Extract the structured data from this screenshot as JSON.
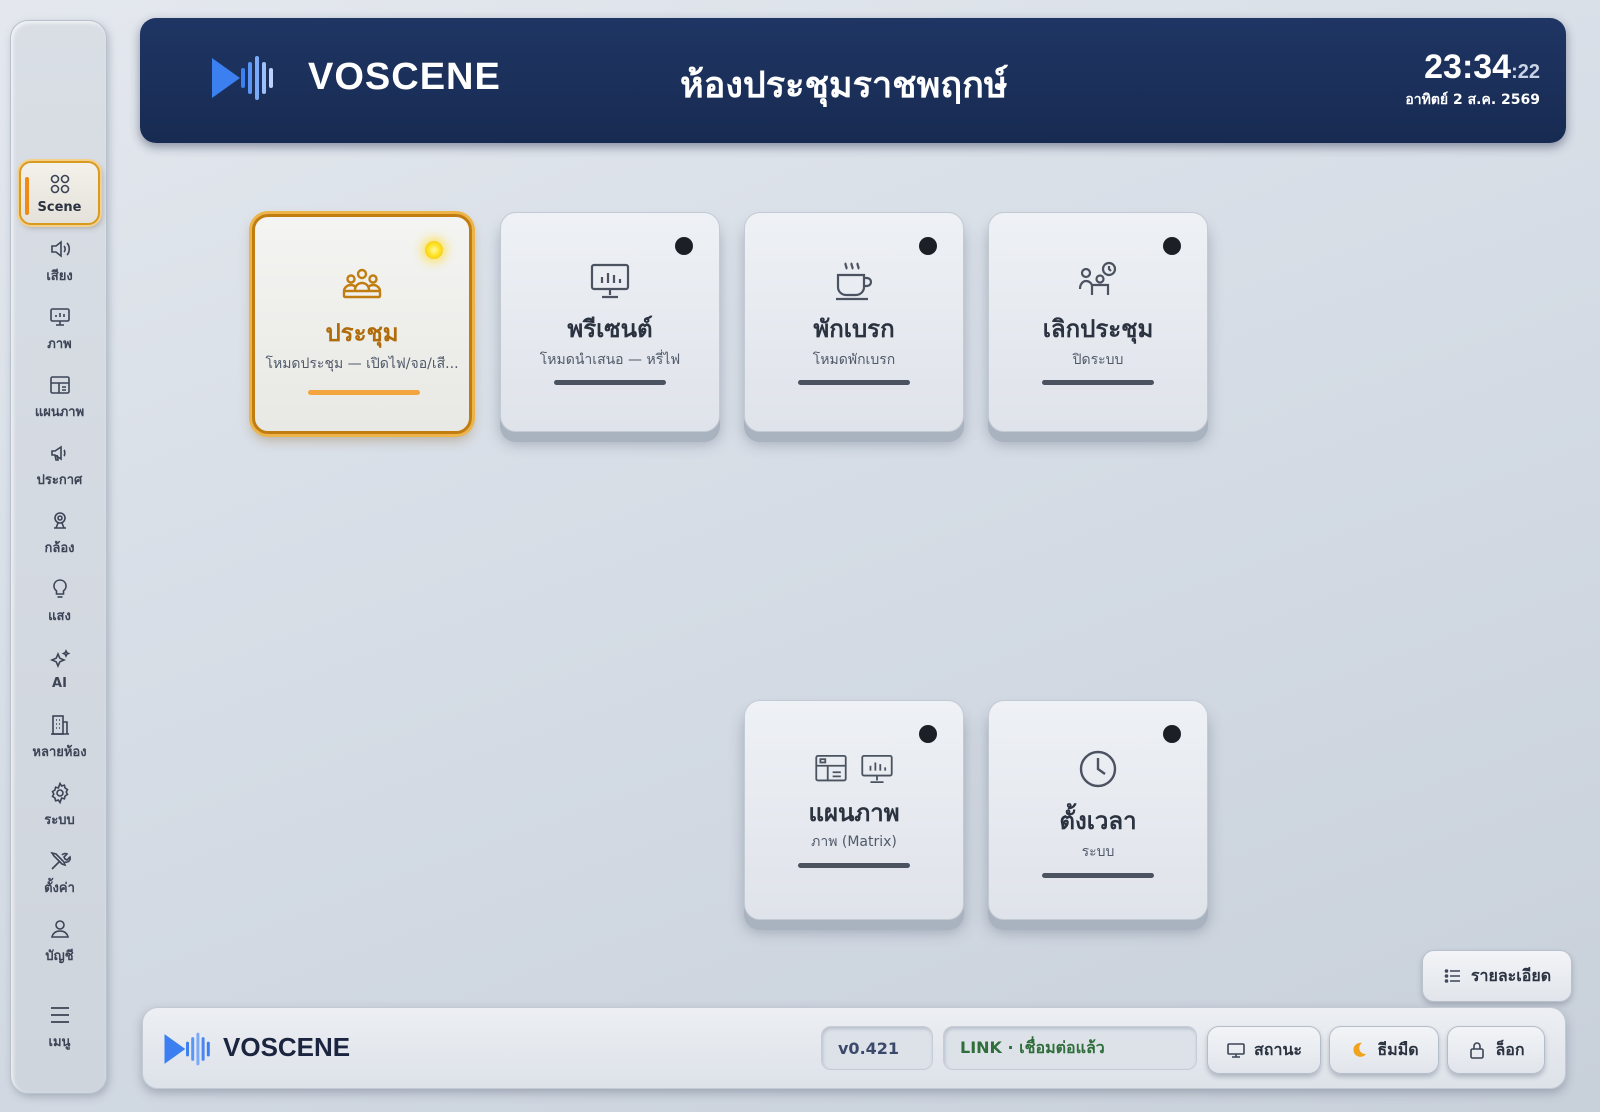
{
  "sidebar": {
    "items": [
      {
        "label": "Scene",
        "icon": "scene-grid-icon",
        "active": true
      },
      {
        "label": "เสียง",
        "icon": "speaker-icon"
      },
      {
        "label": "ภาพ",
        "icon": "monitor-icon"
      },
      {
        "label": "แผนภาพ",
        "icon": "layout-icon"
      },
      {
        "label": "ประกาศ",
        "icon": "announce-icon"
      },
      {
        "label": "กล้อง",
        "icon": "camera-icon"
      },
      {
        "label": "แสง",
        "icon": "bulb-icon"
      },
      {
        "label": "AI",
        "icon": "sparkle-icon"
      },
      {
        "label": "หลายห้อง",
        "icon": "building-icon"
      },
      {
        "label": "ระบบ",
        "icon": "gear-icon"
      },
      {
        "label": "ตั้งค่า",
        "icon": "tools-icon"
      },
      {
        "label": "บัญชี",
        "icon": "user-icon"
      },
      {
        "label": "เมนู",
        "icon": "menu-icon"
      }
    ]
  },
  "header": {
    "brand": "VOSCENE",
    "room_title": "ห้องประชุมราชพฤกษ์",
    "time_hm": "23:34",
    "time_sec": ":22",
    "date": "อาทิตย์ 2 ส.ค. 2569"
  },
  "scenes": [
    {
      "title": "ประชุม",
      "subtitle": "โหมดประชุม — เปิดไฟ/จอ/เสี...",
      "icon": "meeting-people-icon",
      "active": true
    },
    {
      "title": "พรีเซนต์",
      "subtitle": "โหมดนำเสนอ — หรี่ไฟ",
      "icon": "presentation-icon",
      "active": false
    },
    {
      "title": "พักเบรก",
      "subtitle": "โหมดพักเบรก",
      "icon": "coffee-cup-icon",
      "active": false
    },
    {
      "title": "เลิกประชุม",
      "subtitle": "ปิดระบบ",
      "icon": "people-clock-icon",
      "active": false
    },
    {
      "title": "แผนภาพ",
      "subtitle": "ภาพ (Matrix)",
      "icon": "layout-monitor-icon",
      "active": false
    },
    {
      "title": "ตั้งเวลา",
      "subtitle": "ระบบ",
      "icon": "clock-icon",
      "active": false
    }
  ],
  "details_button": {
    "label": "รายละเอียด"
  },
  "footer": {
    "brand": "VOSCENE",
    "version": "v0.421",
    "link_status": "LINK · เชื่อมต่อแล้ว",
    "status_label": "สถานะ",
    "theme_label": "ธีมมืด",
    "lock_label": "ล็อก"
  },
  "colors": {
    "accent": "#ef8a14",
    "header_bg": "#1b2f5a",
    "logo_blue": "#3b7ff0",
    "link_ok": "#2f6e3a"
  }
}
